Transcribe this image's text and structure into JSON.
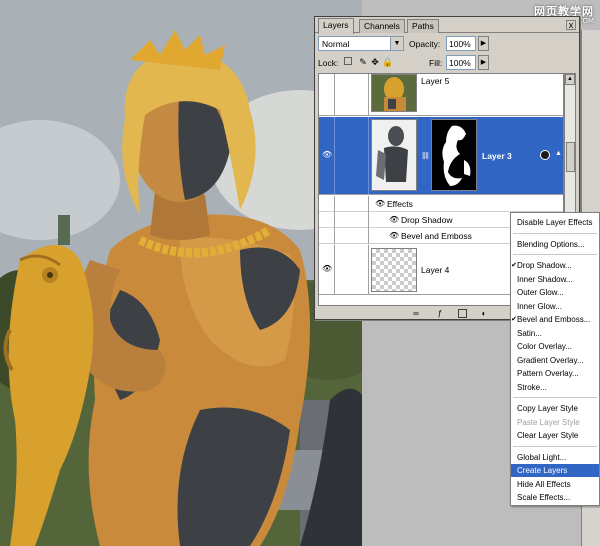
{
  "watermark": {
    "line1": "网页教学网",
    "line2": "WWW.WEBJX.COM"
  },
  "palette": {
    "tabs": [
      "Layers",
      "Channels",
      "Paths"
    ],
    "close": "x",
    "blend_mode": "Normal",
    "opacity_label": "Opacity:",
    "opacity_value": "100%",
    "lock_label": "Lock:",
    "fill_label": "Fill:",
    "fill_value": "100%",
    "layers": [
      {
        "name": "Layer 5",
        "selected": false
      },
      {
        "name": "Layer 3",
        "selected": true
      },
      {
        "name": "Layer 4",
        "selected": false
      }
    ],
    "effects_label": "Effects",
    "effects": [
      "Drop Shadow",
      "Bevel and Emboss"
    ]
  },
  "context_menu": {
    "items": [
      {
        "label": "Disable Layer Effects",
        "enabled": true,
        "checked": false
      },
      {
        "label": "Blending Options...",
        "enabled": true,
        "checked": false
      },
      {
        "label": "Drop Shadow...",
        "enabled": true,
        "checked": true
      },
      {
        "label": "Inner Shadow...",
        "enabled": true,
        "checked": false
      },
      {
        "label": "Outer Glow...",
        "enabled": true,
        "checked": false
      },
      {
        "label": "Inner Glow...",
        "enabled": true,
        "checked": false
      },
      {
        "label": "Bevel and Emboss...",
        "enabled": true,
        "checked": true
      },
      {
        "label": "Satin...",
        "enabled": true,
        "checked": false
      },
      {
        "label": "Color Overlay...",
        "enabled": true,
        "checked": false
      },
      {
        "label": "Gradient Overlay...",
        "enabled": true,
        "checked": false
      },
      {
        "label": "Pattern Overlay...",
        "enabled": true,
        "checked": false
      },
      {
        "label": "Stroke...",
        "enabled": true,
        "checked": false
      },
      {
        "label": "Copy Layer Style",
        "enabled": true,
        "checked": false
      },
      {
        "label": "Paste Layer Style",
        "enabled": false,
        "checked": false
      },
      {
        "label": "Clear Layer Style",
        "enabled": true,
        "checked": false
      },
      {
        "label": "Global Light...",
        "enabled": true,
        "checked": false
      },
      {
        "label": "Create Layers",
        "enabled": true,
        "checked": false,
        "highlighted": true
      },
      {
        "label": "Hide All Effects",
        "enabled": true,
        "checked": false
      },
      {
        "label": "Scale Effects...",
        "enabled": true,
        "checked": false
      }
    ],
    "highlight_color": "#3166c4"
  },
  "colors": {
    "selection": "#3166c4",
    "panel": "#d4d0c8",
    "statue_gold": "#d8a02c",
    "statue_dark": "#3d4146"
  }
}
